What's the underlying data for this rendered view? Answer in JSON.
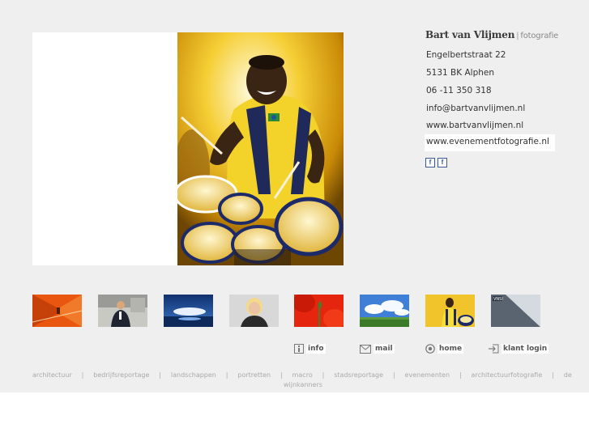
{
  "brand": {
    "name": "Bart van Vlijmen",
    "separator": "|",
    "tagline": "fotografie"
  },
  "contact": {
    "address": "Engelbertstraat 22",
    "city": "5131 BK  Alphen",
    "phone": "06 -11 350 318",
    "email": "info@bartvanvlijmen.nl",
    "website1": "www.bartvanvlijmen.nl",
    "website2": "www.evenementfotografie.nl"
  },
  "social": {
    "icon1": "f",
    "icon2": "f"
  },
  "main_photo": {
    "subject": "drummer-performer"
  },
  "thumbnails": [
    {
      "id": "architectuur",
      "icon": "orange-corridor"
    },
    {
      "id": "bedrijfsreportage",
      "icon": "man-in-suit"
    },
    {
      "id": "landschappen",
      "icon": "blue-sky-lake"
    },
    {
      "id": "portretten",
      "icon": "woman-portrait"
    },
    {
      "id": "macro",
      "icon": "red-flower"
    },
    {
      "id": "landschappen2",
      "icon": "clouds-field"
    },
    {
      "id": "evenementen",
      "icon": "drummer"
    },
    {
      "id": "architectuurfotografie",
      "icon": "building-sign"
    }
  ],
  "nav": {
    "info": "info",
    "mail": "mail",
    "home": "home",
    "login": "klant login"
  },
  "categories": {
    "c1": "architectuur",
    "c2": "bedrijfsreportage",
    "c3": "landschappen",
    "c4": "portretten",
    "c5": "macro",
    "c6": "stadsreportage",
    "c7": "evenementen",
    "c8": "architectuurfotografie",
    "c9": "de",
    "c9b": "wijnkanners",
    "sep": "|"
  },
  "colors": {
    "panel": "#efefef",
    "facebook": "#3b5998",
    "category_text": "#aaaaaa"
  }
}
